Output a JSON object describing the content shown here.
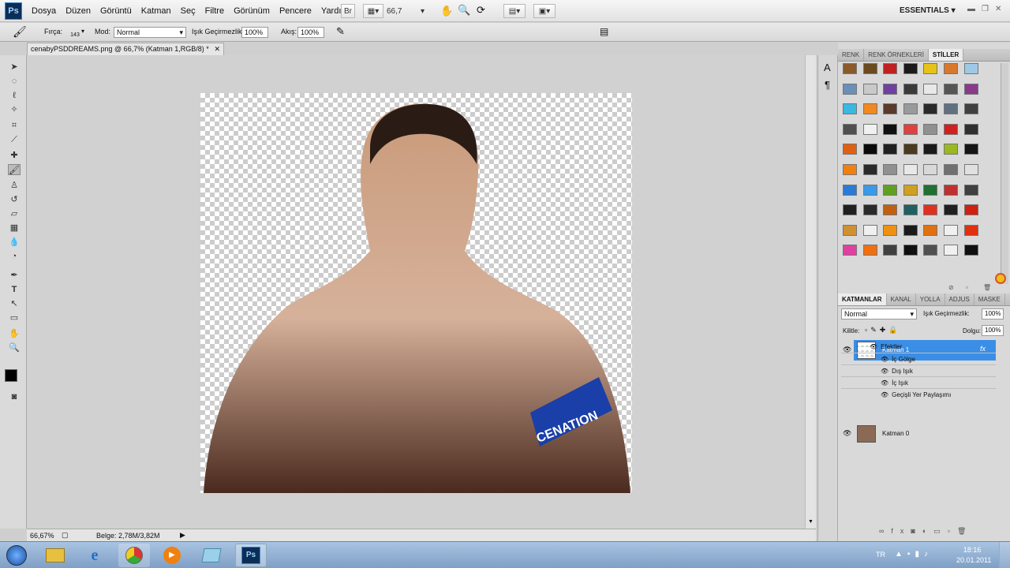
{
  "app": {
    "logo": "Ps"
  },
  "menu": [
    "Dosya",
    "Düzen",
    "Görüntü",
    "Katman",
    "Seç",
    "Filtre",
    "Görünüm",
    "Pencere",
    "Yardım"
  ],
  "menubar": {
    "zoom": "66,7",
    "workspace": "ESSENTIALS"
  },
  "options": {
    "brush_label": "Fırça:",
    "brush_size": "143",
    "mode_label": "Mod:",
    "mode_value": "Normal",
    "opacity_label": "Işık Geçirmezlik:",
    "opacity_value": "100%",
    "flow_label": "Akış:",
    "flow_value": "100%"
  },
  "document": {
    "tab_title": "cenabyPSDDREAMS.png @ 66,7% (Katman 1,RGB/8) *",
    "zoom": "66,67%",
    "doc_size": "Belge: 2,78M/3,82M",
    "armband_text": "CENATION"
  },
  "styles_panel": {
    "tabs": [
      "RENK",
      "RENK ÖRNEKLERİ",
      "STİLLER"
    ],
    "swatches": [
      "#8a5a2b",
      "#6b4a1f",
      "#c02020",
      "#1a1a1a",
      "#e6c21a",
      "#d9772a",
      "#9ec8e8",
      "#6a8fb8",
      "#c9c9c9",
      "#7040a0",
      "#3a3a3a",
      "#e8e8e8",
      "#555555",
      "#8a3a8a",
      "#39b8e0",
      "#f08a20",
      "#5a3a2a",
      "#9a9a9a",
      "#2a2a2a",
      "#607080",
      "#404040",
      "#505050",
      "#f0f0f0",
      "#101010",
      "#e04040",
      "#909090",
      "#d02020",
      "#303030",
      "#e06010",
      "#0a0a0a",
      "#202020",
      "#4a3a20",
      "#1a1a1a",
      "#9ab820",
      "#151515",
      "#f08010",
      "#2a2a2a",
      "#909090",
      "#e8e8e8",
      "#d8d8d8",
      "#707070",
      "#e0e0e0",
      "#2a7ad8",
      "#3a9ae8",
      "#60a020",
      "#d0a020",
      "#207030",
      "#c03030",
      "#404040",
      "#202020",
      "#2a2a2a",
      "#c06010",
      "#206060",
      "#e03020",
      "#202020",
      "#d02010",
      "#d09030",
      "#f0f0f0",
      "#f09010",
      "#1a1a1a",
      "#e07010",
      "#f0f0f0",
      "#e03010",
      "#e040a0",
      "#f07010",
      "#404040",
      "#101010",
      "#505050",
      "#f0f0f0",
      "#101010"
    ]
  },
  "layers_panel": {
    "tabs": [
      "KATMANLAR",
      "KANAL",
      "YOLLA",
      "ADJUS",
      "MASKE"
    ],
    "blend_mode": "Normal",
    "opacity_label": "Işık Geçirmezlik:",
    "opacity_value": "100%",
    "lock_label": "Kilitle:",
    "fill_label": "Dolgu:",
    "fill_value": "100%",
    "layers": [
      {
        "name": "Katman 1"
      },
      {
        "name": "Katman 0"
      }
    ],
    "effects_label": "Efektler",
    "effects": [
      "İç Gölge",
      "Dış Işık",
      "İç Işık",
      "Geçişli Yer Paylaşımı"
    ]
  },
  "taskbar": {
    "lang": "TR",
    "time": "18:16",
    "date": "20.01.2011"
  },
  "colors": {
    "accent": "#3a8ee6",
    "panel": "#d9d9d9",
    "ps_blue": "#0b2e57"
  }
}
